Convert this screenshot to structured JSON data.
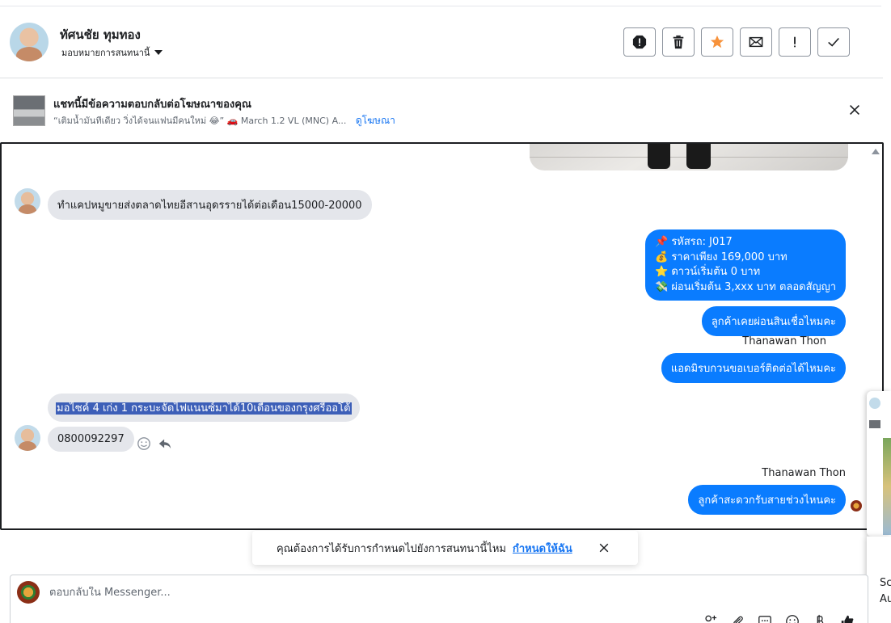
{
  "contact": {
    "name": "ทัศนชัย ทุมทอง",
    "assign_label": "มอบหมายการสนทนานี้"
  },
  "header_actions": [
    {
      "name": "spam-icon"
    },
    {
      "name": "trash-icon"
    },
    {
      "name": "star-icon"
    },
    {
      "name": "mail-icon"
    },
    {
      "name": "exclamation-icon"
    },
    {
      "name": "check-icon"
    }
  ],
  "ad_banner": {
    "title": "แชทนี้มีข้อความตอบกลับต่อโฆษณาของคุณ",
    "snippet": "“เติมน้ำมันทีเดียว วิ่งได้จนแฟนมีคนใหม่ 😂” 🚗 March 1.2 VL (MNC) A...",
    "link": "ดูโฆษณา"
  },
  "messages": {
    "m1": "ทำแคปหมูขายส่งตลาดไทยอีสานอุดรรายได้ต่อเดือน15000-20000",
    "info_lines": [
      {
        "emoji": "📌",
        "text": "รหัสรถ: J017"
      },
      {
        "emoji": "💰",
        "text": "ราคาเพียง 169,000 บาท"
      },
      {
        "emoji": "⭐",
        "text": "ดาวน์เริ่มต้น 0 บาท"
      },
      {
        "emoji": "💸",
        "text": "ผ่อนเริ่มต้น 3,xxx บาท ตลอดสัญญา"
      }
    ],
    "m3": "ลูกค้าเคยผ่อนสินเชื่อไหมคะ",
    "sender_1": "Thanawan Thon",
    "m4": "แอดมิรบกวนขอเบอร์ติดต่อได้ไหมคะ",
    "m5": "มอไซค์ 4 เก่ง 1 กระบะจัดไฟแนนซ์มาได้10เดือนของกรุงศรีออโต้",
    "m6": "0800092297",
    "sender_2": "Thanawan Thon",
    "m7": "ลูกค้าสะดวกรับสายช่วงไหนคะ"
  },
  "toast": {
    "text": "คุณต้องการได้รับการกำหนดไปยังการสนทนานี้ไหม",
    "link": "กำหนดให้ฉัน"
  },
  "composer": {
    "placeholder": "ตอบกลับใน Messenger..."
  },
  "side_panel": {
    "text_1": "Sc",
    "text_2": "Au"
  },
  "colors": {
    "outgoing_bubble": "#0a7cff",
    "incoming_bubble": "#e4e6eb",
    "link": "#1876f2",
    "star": "#f7923b"
  }
}
